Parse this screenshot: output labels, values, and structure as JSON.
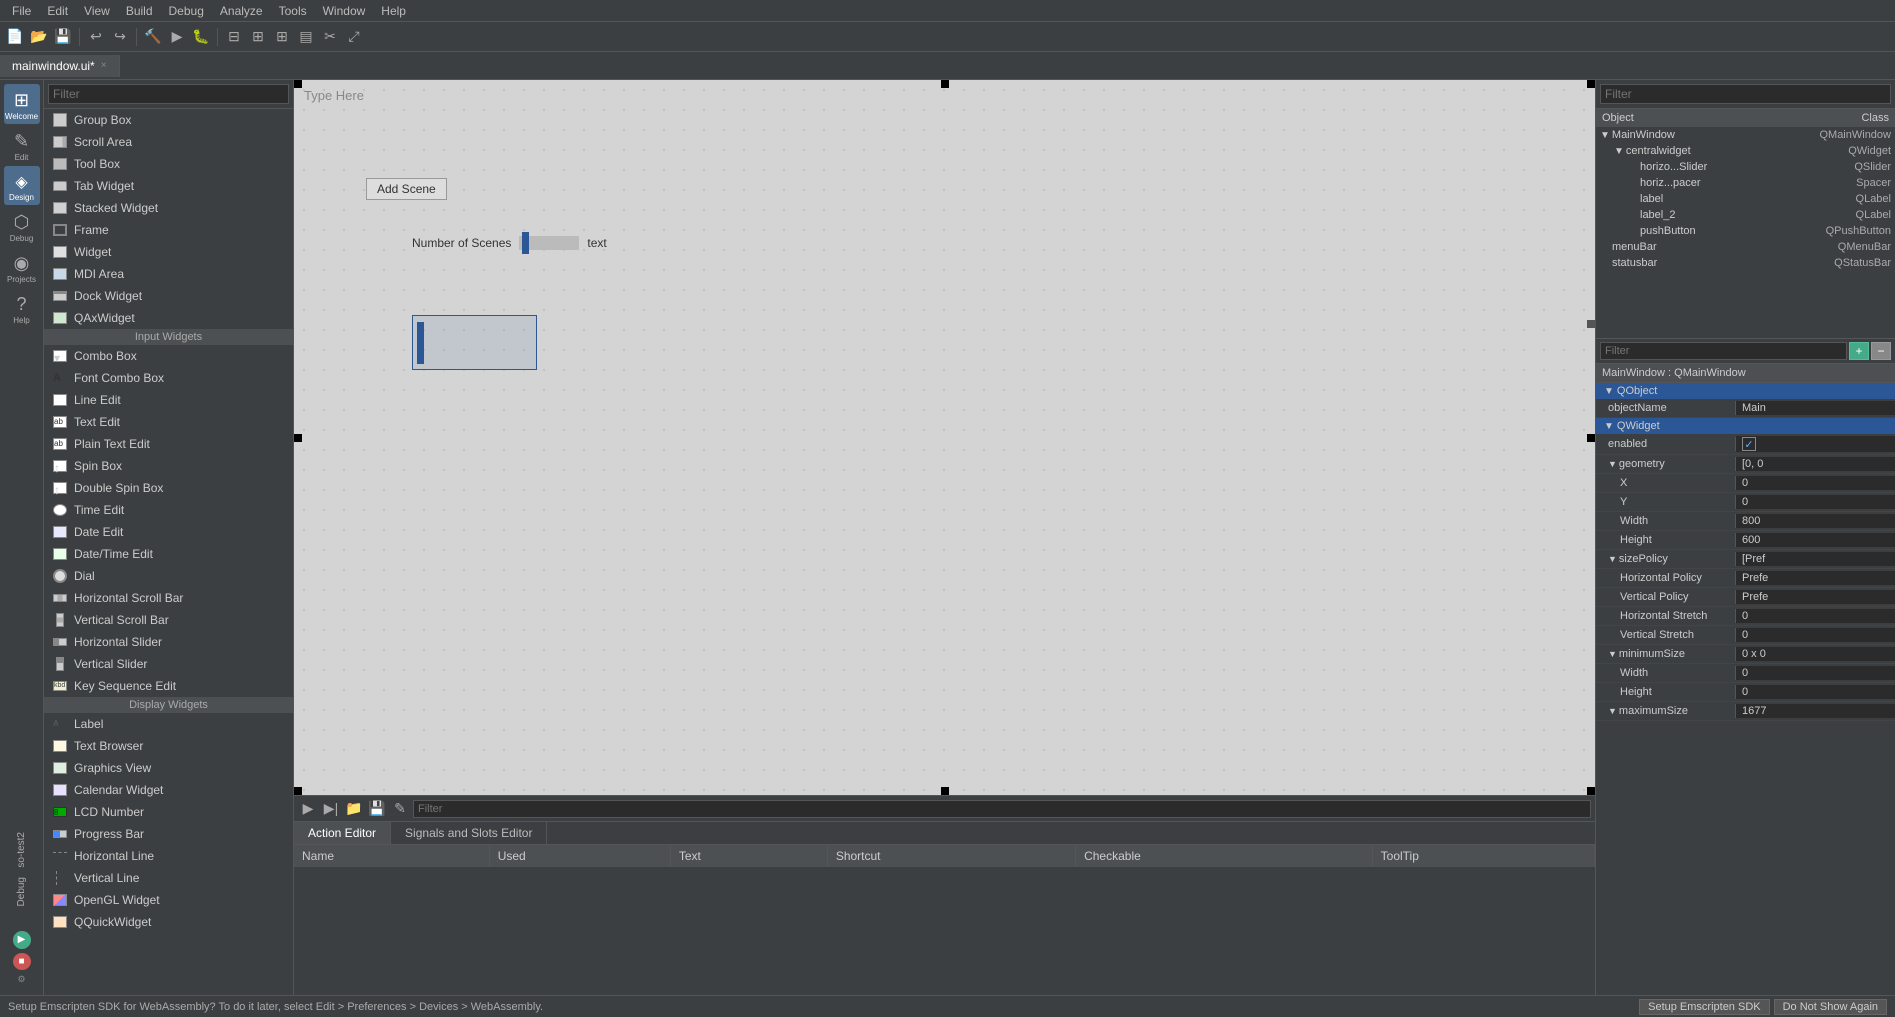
{
  "menubar": {
    "items": [
      "File",
      "Edit",
      "View",
      "Build",
      "Debug",
      "Analyze",
      "Tools",
      "Window",
      "Help"
    ]
  },
  "tab": {
    "filename": "mainwindow.ui*",
    "close": "×"
  },
  "filter_left": {
    "placeholder": "Filter"
  },
  "widget_sections": [
    {
      "type": "items",
      "items": [
        {
          "label": "Group Box",
          "icon": "box"
        },
        {
          "label": "Scroll Area",
          "icon": "scroll"
        },
        {
          "label": "Tool Box",
          "icon": "tool"
        },
        {
          "label": "Tab Widget",
          "icon": "tab"
        },
        {
          "label": "Stacked Widget",
          "icon": "stacked"
        },
        {
          "label": "Frame",
          "icon": "frame"
        },
        {
          "label": "Widget",
          "icon": "widget"
        },
        {
          "label": "MDI Area",
          "icon": "mdi"
        },
        {
          "label": "Dock Widget",
          "icon": "dock"
        },
        {
          "label": "QAxWidget",
          "icon": "qax"
        }
      ]
    },
    {
      "type": "section",
      "label": "Input Widgets",
      "items": [
        {
          "label": "Combo Box",
          "icon": "combo"
        },
        {
          "label": "Font Combo Box",
          "icon": "font"
        },
        {
          "label": "Line Edit",
          "icon": "line"
        },
        {
          "label": "Text Edit",
          "icon": "textedit"
        },
        {
          "label": "Plain Text Edit",
          "icon": "textedit"
        },
        {
          "label": "Spin Box",
          "icon": "spin"
        },
        {
          "label": "Double Spin Box",
          "icon": "spin"
        },
        {
          "label": "Time Edit",
          "icon": "time"
        },
        {
          "label": "Date Edit",
          "icon": "date"
        },
        {
          "label": "Date/Time Edit",
          "icon": "datetime"
        },
        {
          "label": "Dial",
          "icon": "dial"
        },
        {
          "label": "Horizontal Scroll Bar",
          "icon": "hscroll"
        },
        {
          "label": "Vertical Scroll Bar",
          "icon": "vscroll"
        },
        {
          "label": "Horizontal Slider",
          "icon": "hslider"
        },
        {
          "label": "Vertical Slider",
          "icon": "vslider"
        },
        {
          "label": "Key Sequence Edit",
          "icon": "keyseq"
        }
      ]
    },
    {
      "type": "section",
      "label": "Display Widgets",
      "items": [
        {
          "label": "Label",
          "icon": "label"
        },
        {
          "label": "Text Browser",
          "icon": "browser"
        },
        {
          "label": "Graphics View",
          "icon": "gview"
        },
        {
          "label": "Calendar Widget",
          "icon": "calendar"
        },
        {
          "label": "LCD Number",
          "icon": "lcd"
        },
        {
          "label": "Progress Bar",
          "icon": "progress"
        },
        {
          "label": "Horizontal Line",
          "icon": "hline"
        },
        {
          "label": "Vertical Line",
          "icon": "vline"
        },
        {
          "label": "OpenGL Widget",
          "icon": "opengl"
        },
        {
          "label": "QQuickWidget",
          "icon": "qquick"
        }
      ]
    }
  ],
  "canvas": {
    "type_here": "Type Here",
    "add_scene_btn": "Add Scene",
    "number_of_scenes_label": "Number of Scenes",
    "text_label": "text"
  },
  "icon_sidebar": [
    {
      "sym": "⊞",
      "lbl": "Welcome"
    },
    {
      "sym": "✎",
      "lbl": "Edit"
    },
    {
      "sym": "◈",
      "lbl": "Design",
      "selected": true
    },
    {
      "sym": "⬢",
      "lbl": "Debug"
    },
    {
      "sym": "◉",
      "lbl": "Projects"
    },
    {
      "sym": "?",
      "lbl": "Help"
    }
  ],
  "project_labels": [
    "so-test2",
    "Debug"
  ],
  "object_panel": {
    "filter_placeholder": "Filter",
    "cols": [
      "Object",
      "Class"
    ],
    "rows": [
      {
        "level": 0,
        "name": "MainWindow",
        "class": "QMainWindow",
        "arrow": "▼",
        "expand": true
      },
      {
        "level": 1,
        "name": "centralwidget",
        "class": "QWidget",
        "arrow": "▼",
        "expand": true
      },
      {
        "level": 2,
        "name": "horizo...Slider",
        "class": "QSlider",
        "arrow": "",
        "expand": false
      },
      {
        "level": 2,
        "name": "horiz...pacer",
        "class": "Spacer",
        "arrow": "",
        "expand": false
      },
      {
        "level": 2,
        "name": "label",
        "class": "QLabel",
        "arrow": "",
        "expand": false
      },
      {
        "level": 2,
        "name": "label_2",
        "class": "QLabel",
        "arrow": "",
        "expand": false
      },
      {
        "level": 2,
        "name": "pushButton",
        "class": "QPushButton",
        "arrow": "",
        "expand": false
      },
      {
        "level": 0,
        "name": "menuBar",
        "class": "QMenuBar",
        "arrow": "",
        "expand": false
      },
      {
        "level": 0,
        "name": "statusbar",
        "class": "QStatusBar",
        "arrow": "",
        "expand": false
      }
    ]
  },
  "property_panel": {
    "filter_placeholder": "Filter",
    "title": "MainWindow : QMainWindow",
    "sections": [
      {
        "name": "QObject",
        "collapsed": false,
        "rows": [
          {
            "name": "objectName",
            "value": "Main",
            "indented": true,
            "type": "text"
          }
        ]
      },
      {
        "name": "QWidget",
        "collapsed": false,
        "rows": [
          {
            "name": "enabled",
            "value": "✓",
            "indented": true,
            "type": "check"
          },
          {
            "name": "geometry",
            "value": "[0, 0",
            "indented": true,
            "type": "text",
            "expand": true
          },
          {
            "name": "X",
            "value": "0",
            "indented": true,
            "type": "text",
            "sub": true
          },
          {
            "name": "Y",
            "value": "0",
            "indented": true,
            "type": "text",
            "sub": true
          },
          {
            "name": "Width",
            "value": "800",
            "indented": true,
            "type": "text",
            "sub": true
          },
          {
            "name": "Height",
            "value": "600",
            "indented": true,
            "type": "text",
            "sub": true
          },
          {
            "name": "sizePolicy",
            "value": "[Pref",
            "indented": true,
            "type": "text",
            "expand": true
          },
          {
            "name": "Horizontal Policy",
            "value": "Prefe",
            "indented": true,
            "type": "text",
            "sub": true
          },
          {
            "name": "Vertical Policy",
            "value": "Prefe",
            "indented": true,
            "type": "text",
            "sub": true
          },
          {
            "name": "Horizontal Stretch",
            "value": "0",
            "indented": true,
            "type": "text",
            "sub": true
          },
          {
            "name": "Vertical Stretch",
            "value": "0",
            "indented": true,
            "type": "text",
            "sub": true
          },
          {
            "name": "minimumSize",
            "value": "0 x 0",
            "indented": true,
            "type": "text",
            "expand": true
          },
          {
            "name": "Width",
            "value": "0",
            "indented": true,
            "type": "text",
            "sub": true
          },
          {
            "name": "Height",
            "value": "0",
            "indented": true,
            "type": "text",
            "sub": true
          },
          {
            "name": "maximumSize",
            "value": "1677",
            "indented": true,
            "type": "text",
            "expand": true
          }
        ]
      }
    ]
  },
  "bottom_panel": {
    "tabs": [
      "Action Editor",
      "Signals and Slots Editor"
    ],
    "active_tab": "Action Editor",
    "filter_placeholder": "Filter",
    "columns": [
      "Name",
      "Used",
      "Text",
      "Shortcut",
      "Checkable",
      "ToolTip"
    ],
    "toolbar_icons": [
      "▶",
      "▶|",
      "📁",
      "💾",
      "✎"
    ]
  },
  "status_bar": {
    "message": "Setup Emscripten SDK for WebAssembly? To do it later, select Edit > Preferences > Devices > WebAssembly.",
    "btn1": "Setup Emscripten SDK",
    "btn2": "Do Not Show Again"
  }
}
